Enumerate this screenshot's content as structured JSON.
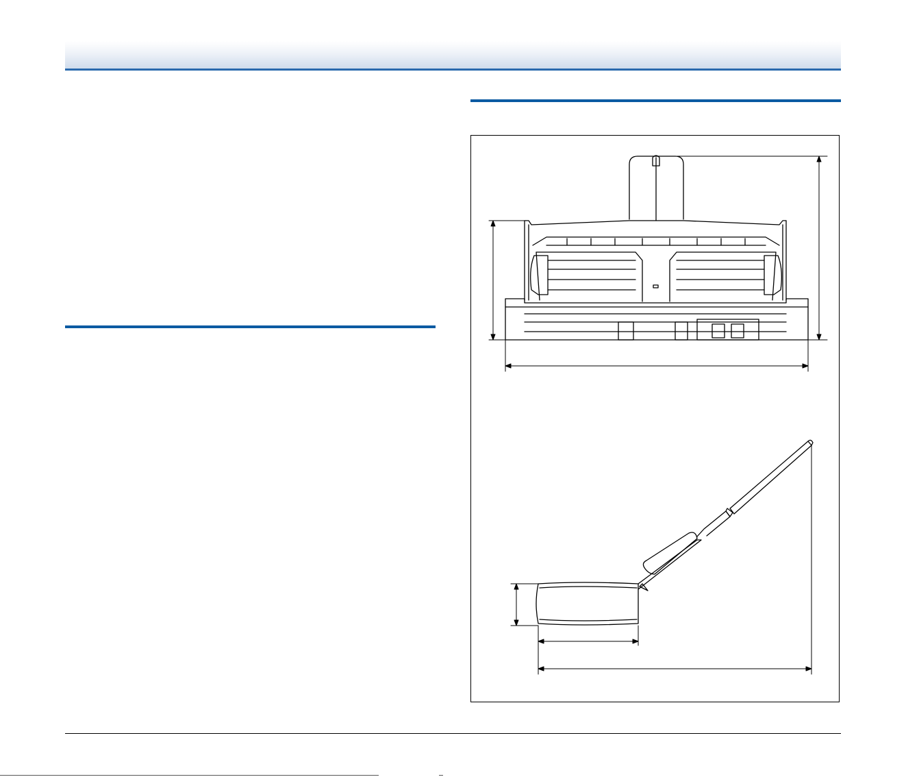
{
  "page": {
    "header_color": "#2a69ad",
    "section_rule_color": "#0b5aa2"
  },
  "figures": [
    {
      "view": "front",
      "description_icon": "scanner-front-view-icon"
    },
    {
      "view": "side",
      "description_icon": "scanner-side-view-icon"
    }
  ]
}
